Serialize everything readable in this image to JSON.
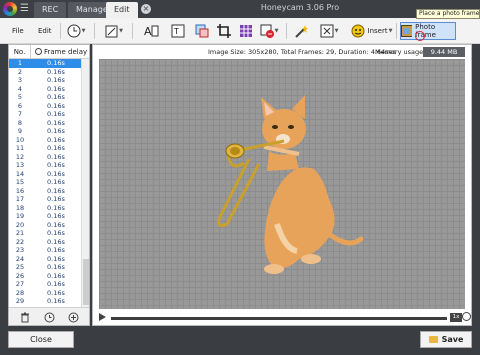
{
  "titlebar": {
    "title": "Honeycam 3.06 Pro",
    "tabs": [
      {
        "label": "REC"
      },
      {
        "label": "Manage"
      },
      {
        "label": "Edit"
      }
    ]
  },
  "toolbar": {
    "file_label": "File",
    "edit_label": "Edit",
    "insert_label": "Insert",
    "photo_frame_label": "Photo frame",
    "tooltip": "Place a photo frame over the image"
  },
  "frames": {
    "header_no": "No.",
    "header_delay": "Frame delay",
    "rows": [
      {
        "n": "1",
        "d": "0.16s"
      },
      {
        "n": "2",
        "d": "0.16s"
      },
      {
        "n": "3",
        "d": "0.16s"
      },
      {
        "n": "4",
        "d": "0.16s"
      },
      {
        "n": "5",
        "d": "0.16s"
      },
      {
        "n": "6",
        "d": "0.16s"
      },
      {
        "n": "7",
        "d": "0.16s"
      },
      {
        "n": "8",
        "d": "0.16s"
      },
      {
        "n": "9",
        "d": "0.16s"
      },
      {
        "n": "10",
        "d": "0.16s"
      },
      {
        "n": "11",
        "d": "0.16s"
      },
      {
        "n": "12",
        "d": "0.16s"
      },
      {
        "n": "13",
        "d": "0.16s"
      },
      {
        "n": "14",
        "d": "0.16s"
      },
      {
        "n": "15",
        "d": "0.16s"
      },
      {
        "n": "16",
        "d": "0.16s"
      },
      {
        "n": "17",
        "d": "0.16s"
      },
      {
        "n": "18",
        "d": "0.16s"
      },
      {
        "n": "19",
        "d": "0.16s"
      },
      {
        "n": "20",
        "d": "0.16s"
      },
      {
        "n": "21",
        "d": "0.16s"
      },
      {
        "n": "22",
        "d": "0.16s"
      },
      {
        "n": "23",
        "d": "0.16s"
      },
      {
        "n": "24",
        "d": "0.16s"
      },
      {
        "n": "25",
        "d": "0.16s"
      },
      {
        "n": "26",
        "d": "0.16s"
      },
      {
        "n": "27",
        "d": "0.16s"
      },
      {
        "n": "28",
        "d": "0.16s"
      },
      {
        "n": "29",
        "d": "0.16s"
      }
    ]
  },
  "info": {
    "text": "Image Size: 305x280, Total Frames: 29, Duration: 4.64sec",
    "memory_label": "Memory usage",
    "memory_value": "9.44 MB"
  },
  "playbar": {
    "speed": "1x"
  },
  "footer": {
    "close_label": "Close",
    "save_label": "Save"
  }
}
